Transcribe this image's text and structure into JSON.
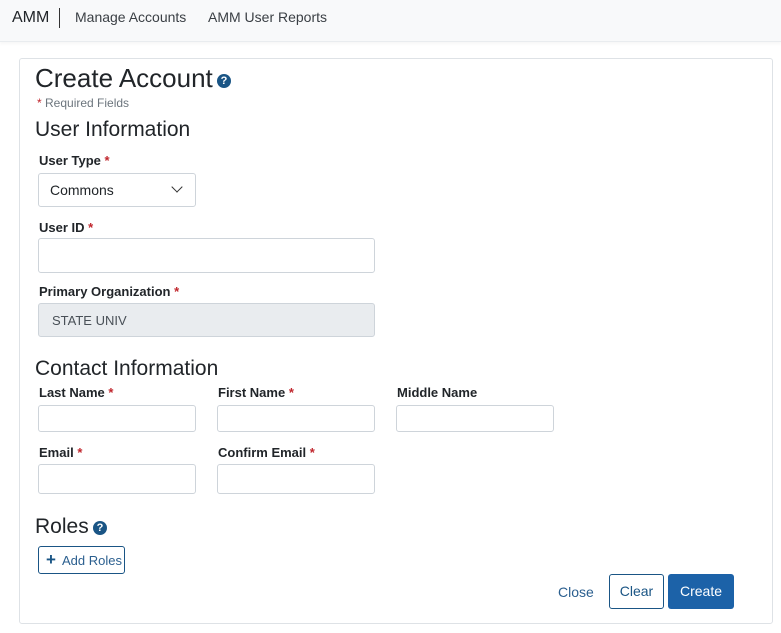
{
  "nav": {
    "brand": "AMM",
    "items": [
      {
        "label": "Manage Accounts"
      },
      {
        "label": "AMM User Reports"
      }
    ]
  },
  "page": {
    "title": "Create Account",
    "help_icon": "?",
    "required_marker": "*",
    "required_note": "Required Fields"
  },
  "user_info": {
    "title": "User Information",
    "user_type": {
      "label": "User Type",
      "value": "Commons"
    },
    "user_id": {
      "label": "User ID",
      "value": ""
    },
    "primary_org": {
      "label": "Primary Organization",
      "value": "STATE UNIV"
    }
  },
  "contact_info": {
    "title": "Contact Information",
    "last_name": {
      "label": "Last Name",
      "value": ""
    },
    "first_name": {
      "label": "First Name",
      "value": ""
    },
    "middle_name": {
      "label": "Middle Name",
      "value": ""
    },
    "email": {
      "label": "Email",
      "value": ""
    },
    "confirm_email": {
      "label": "Confirm Email",
      "value": ""
    }
  },
  "roles": {
    "title": "Roles",
    "add_button_icon": "+",
    "add_button_label": "Add Roles"
  },
  "actions": {
    "close_label": "Close",
    "clear_label": "Clear",
    "create_label": "Create"
  },
  "colors": {
    "primary": "#1c62a8",
    "required": "#c0262d",
    "help_icon": "#1a5585"
  }
}
